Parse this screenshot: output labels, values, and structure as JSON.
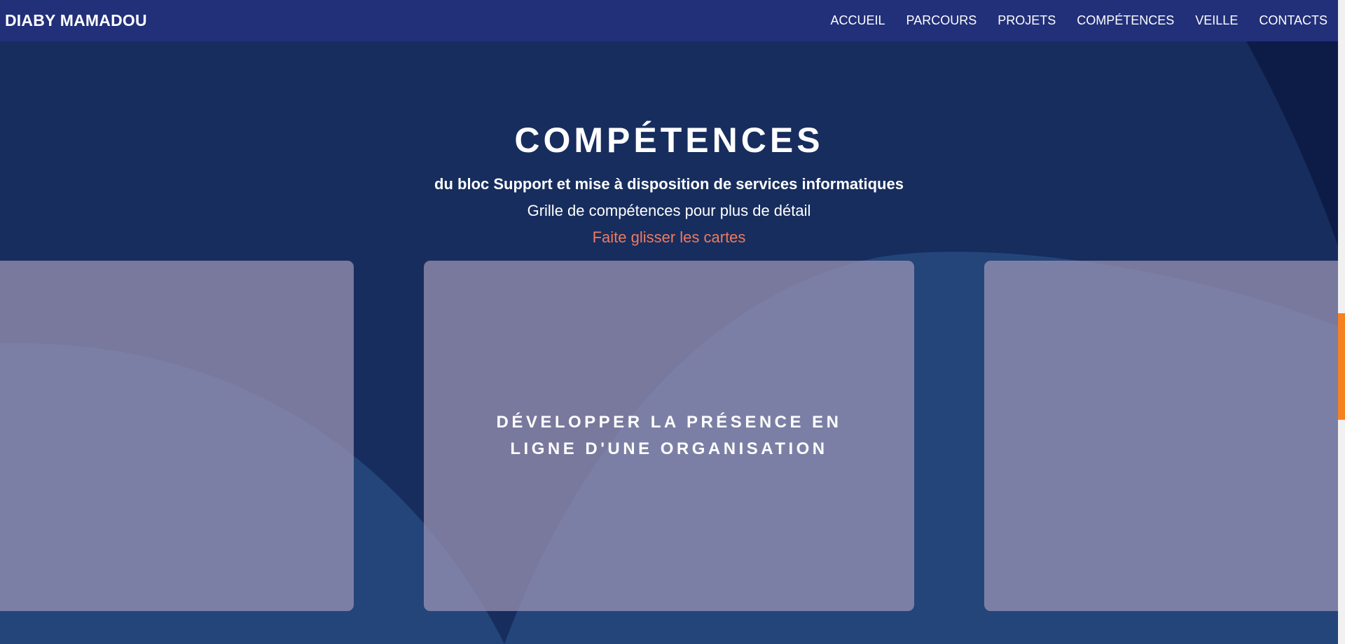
{
  "navbar": {
    "brand": "DIABY MAMADOU",
    "links": [
      "ACCUEIL",
      "PARCOURS",
      "PROJETS",
      "COMPÉTENCES",
      "VEILLE",
      "CONTACTS"
    ]
  },
  "section": {
    "title": "COMPÉTENCES",
    "subtitle": "du bloc Support et mise à disposition de services informatiques",
    "grid_link": "Grille de compétences pour plus de détail",
    "hint": "Faite glisser les cartes"
  },
  "cards": {
    "left_title": "",
    "center_title": "DÉVELOPPER LA PRÉSENCE EN LIGNE D'UNE ORGANISATION",
    "right_title": ""
  },
  "colors": {
    "navbar_bg": "#222f79",
    "page_bg": "#23457a",
    "dark_shape": "#172d5e",
    "hint_text": "#f07a5e",
    "scroll_thumb": "#f58220"
  }
}
